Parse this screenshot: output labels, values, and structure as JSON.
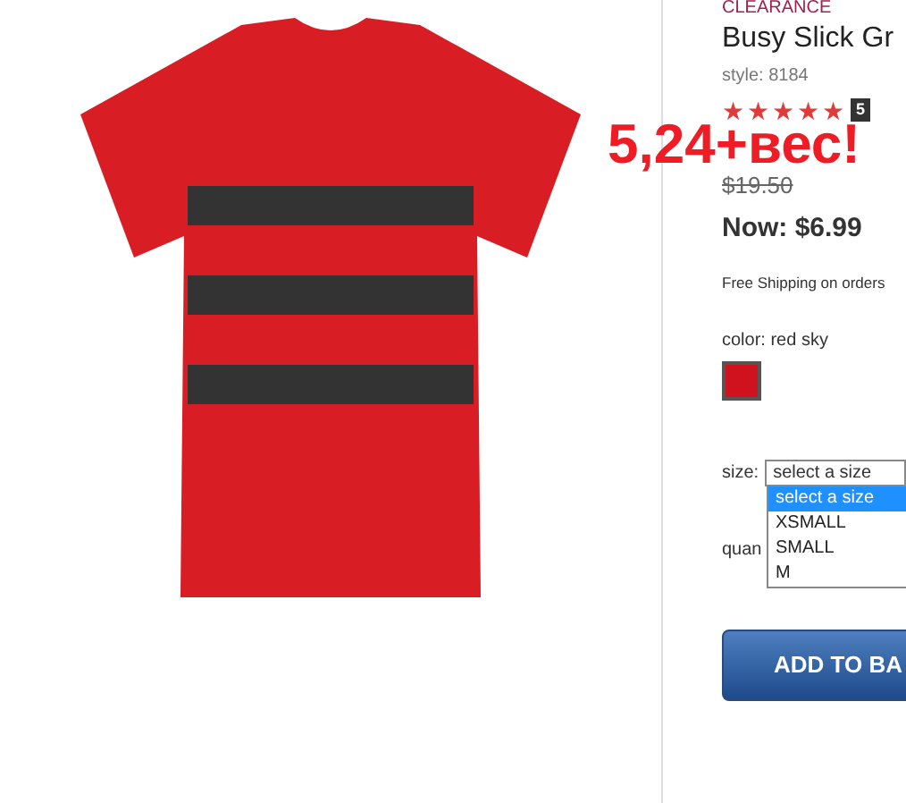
{
  "product": {
    "tag": "CLEARANCE",
    "title": "Busy Slick Gr",
    "style": "style: 8184",
    "stars": 5,
    "rating_badge": "5",
    "was_price": "$19.50",
    "now_price": "Now: $6.99",
    "shipping": "Free Shipping on orders",
    "color_label": "color: red sky",
    "swatches": [
      {
        "color": "#d0121f",
        "selected": true
      }
    ],
    "size_label": "size:",
    "size_select": {
      "value": "select a size",
      "expanded": true,
      "options": [
        {
          "label": "select a size",
          "selected": true
        },
        {
          "label": "XSMALL",
          "selected": false
        },
        {
          "label": "SMALL",
          "selected": false
        },
        {
          "label": "M",
          "selected": false
        }
      ]
    },
    "quantity_label": "quan",
    "add_button": "ADD TO BA"
  },
  "annotation": "5,24+вес!"
}
